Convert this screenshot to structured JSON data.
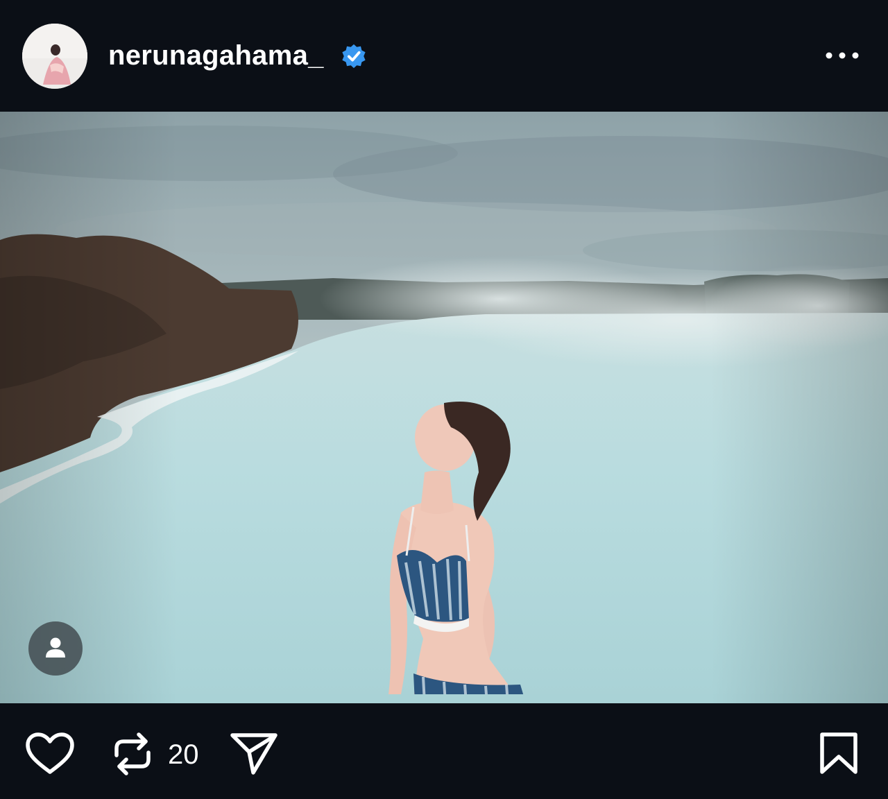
{
  "post": {
    "username": "nerunagahama_",
    "verified": true,
    "avatar_icon": "profile-photo",
    "more_icon": "ellipsis-icon",
    "photo_description_icon": "lagoon-photo",
    "tag_icon": "person-icon"
  },
  "actions": {
    "like_icon": "heart-outline-icon",
    "repost_icon": "repost-icon",
    "repost_count": "20",
    "share_icon": "paper-plane-icon",
    "save_icon": "bookmark-outline-icon"
  },
  "colors": {
    "background": "#0b0f16",
    "verified_badge": "#3897f0",
    "icon": "#ffffff"
  }
}
